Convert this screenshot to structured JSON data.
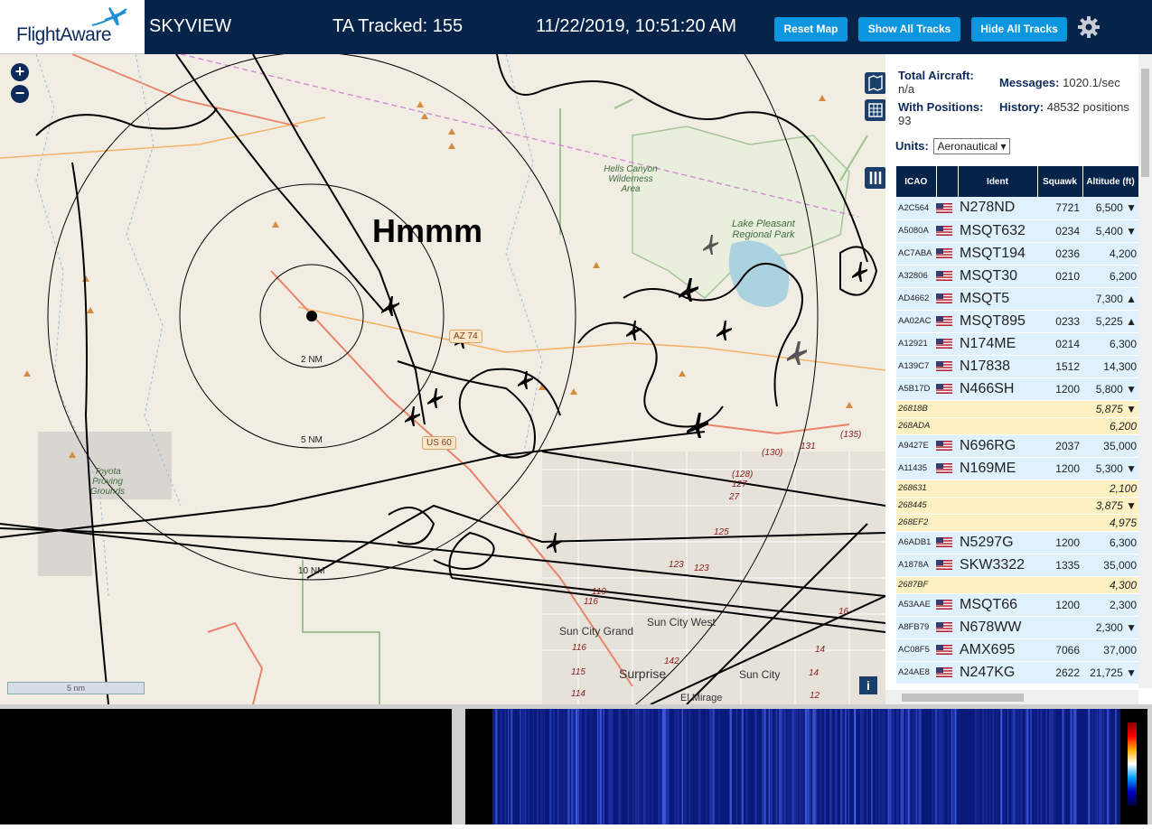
{
  "header": {
    "logo_text": "FlightAware",
    "app_name": "SKYVIEW",
    "ta_tracked": "TA Tracked: 155",
    "datetime": "11/22/2019, 10:51:20 AM",
    "buttons": {
      "reset_map": "Reset Map",
      "show_all_tracks": "Show All Tracks",
      "hide_all_tracks": "Hide All Tracks"
    },
    "settings_icon": "gear-icon"
  },
  "map": {
    "annotation": "Hmmm",
    "zoom_in": "+",
    "zoom_out": "−",
    "rings": [
      "2 NM",
      "5 NM",
      "10 NM"
    ],
    "scale": "5 nm",
    "info": "i",
    "roads": [
      "AZ 74",
      "US 60"
    ],
    "road_numbers": [
      "131",
      "(130)",
      "(135)",
      "(128)",
      "127",
      "27",
      "125",
      "123",
      "123",
      "119",
      "116",
      "116",
      "115",
      "114",
      "142",
      "14",
      "14",
      "12",
      "16"
    ],
    "places": [
      "Sun City Grand",
      "Sun City West",
      "Surprise",
      "Sun City",
      "El Mirage"
    ],
    "parks": [
      "Hells Canyon Wilderness Area",
      "Lake Pleasant Regional Park",
      "Toyota Proving Grounds"
    ],
    "colors": {
      "background": "#f1ede3",
      "track": "#000000",
      "range_ring": "#000000",
      "aircraft": "#000000"
    }
  },
  "stats": {
    "total_aircraft_label": "Total Aircraft:",
    "total_aircraft": "n/a",
    "messages_label": "Messages:",
    "messages": "1020.1/sec",
    "with_positions_label": "With Positions:",
    "with_positions": "93",
    "history_label": "History:",
    "history": "48532 positions",
    "units_label": "Units:",
    "units_value": "Aeronautical"
  },
  "table": {
    "headers": [
      "ICAO",
      "",
      "Ident",
      "Squawk",
      "Altitude (ft)"
    ],
    "rows": [
      {
        "icao": "A2C564",
        "flag": true,
        "ident": "N278ND",
        "squawk": "7721",
        "alt": "6,500",
        "trend": "▼",
        "color": "blue"
      },
      {
        "icao": "A5080A",
        "flag": true,
        "ident": "MSQT632",
        "squawk": "0234",
        "alt": "5,400",
        "trend": "▼",
        "color": "blue"
      },
      {
        "icao": "AC7ABA",
        "flag": true,
        "ident": "MSQT194",
        "squawk": "0236",
        "alt": "4,200",
        "trend": "",
        "color": "blue"
      },
      {
        "icao": "A32806",
        "flag": true,
        "ident": "MSQT30",
        "squawk": "0210",
        "alt": "6,200",
        "trend": "",
        "color": "blue"
      },
      {
        "icao": "AD4662",
        "flag": true,
        "ident": "MSQT5",
        "squawk": "",
        "alt": "7,300",
        "trend": "▲",
        "color": "blue"
      },
      {
        "icao": "AA02AC",
        "flag": true,
        "ident": "MSQT895",
        "squawk": "0233",
        "alt": "5,225",
        "trend": "▲",
        "color": "blue"
      },
      {
        "icao": "A12921",
        "flag": true,
        "ident": "N174ME",
        "squawk": "0214",
        "alt": "6,300",
        "trend": "",
        "color": "blue"
      },
      {
        "icao": "A139C7",
        "flag": true,
        "ident": "N17838",
        "squawk": "1512",
        "alt": "14,300",
        "trend": "",
        "color": "blue"
      },
      {
        "icao": "A5B17D",
        "flag": true,
        "ident": "N466SH",
        "squawk": "1200",
        "alt": "5,800",
        "trend": "▼",
        "color": "blue"
      },
      {
        "icao": "26818B",
        "flag": false,
        "ident": "",
        "squawk": "",
        "alt": "5,875",
        "trend": "▼",
        "color": "yellow"
      },
      {
        "icao": "268ADA",
        "flag": false,
        "ident": "",
        "squawk": "",
        "alt": "6,200",
        "trend": "",
        "color": "yellow"
      },
      {
        "icao": "A9427E",
        "flag": true,
        "ident": "N696RG",
        "squawk": "2037",
        "alt": "35,000",
        "trend": "",
        "color": "blue"
      },
      {
        "icao": "A11435",
        "flag": true,
        "ident": "N169ME",
        "squawk": "1200",
        "alt": "5,300",
        "trend": "▼",
        "color": "blue"
      },
      {
        "icao": "268631",
        "flag": false,
        "ident": "",
        "squawk": "",
        "alt": "2,100",
        "trend": "",
        "color": "yellow"
      },
      {
        "icao": "268445",
        "flag": false,
        "ident": "",
        "squawk": "",
        "alt": "3,875",
        "trend": "▼",
        "color": "yellow"
      },
      {
        "icao": "268EF2",
        "flag": false,
        "ident": "",
        "squawk": "",
        "alt": "4,975",
        "trend": "",
        "color": "yellow"
      },
      {
        "icao": "A6ADB1",
        "flag": true,
        "ident": "N5297G",
        "squawk": "1200",
        "alt": "6,300",
        "trend": "",
        "color": "blue"
      },
      {
        "icao": "A1878A",
        "flag": true,
        "ident": "SKW3322",
        "squawk": "1335",
        "alt": "35,000",
        "trend": "",
        "color": "blue"
      },
      {
        "icao": "2687BF",
        "flag": false,
        "ident": "",
        "squawk": "",
        "alt": "4,300",
        "trend": "",
        "color": "yellow"
      },
      {
        "icao": "A53AAE",
        "flag": true,
        "ident": "MSQT66",
        "squawk": "1200",
        "alt": "2,300",
        "trend": "",
        "color": "blue"
      },
      {
        "icao": "A8FB79",
        "flag": true,
        "ident": "N678WW",
        "squawk": "",
        "alt": "2,300",
        "trend": "▼",
        "color": "blue"
      },
      {
        "icao": "AC08F5",
        "flag": true,
        "ident": "AMX695",
        "squawk": "7066",
        "alt": "37,000",
        "trend": "",
        "color": "blue"
      },
      {
        "icao": "A24AE8",
        "flag": true,
        "ident": "N247KG",
        "squawk": "2622",
        "alt": "21,725",
        "trend": "▼",
        "color": "blue"
      }
    ]
  }
}
